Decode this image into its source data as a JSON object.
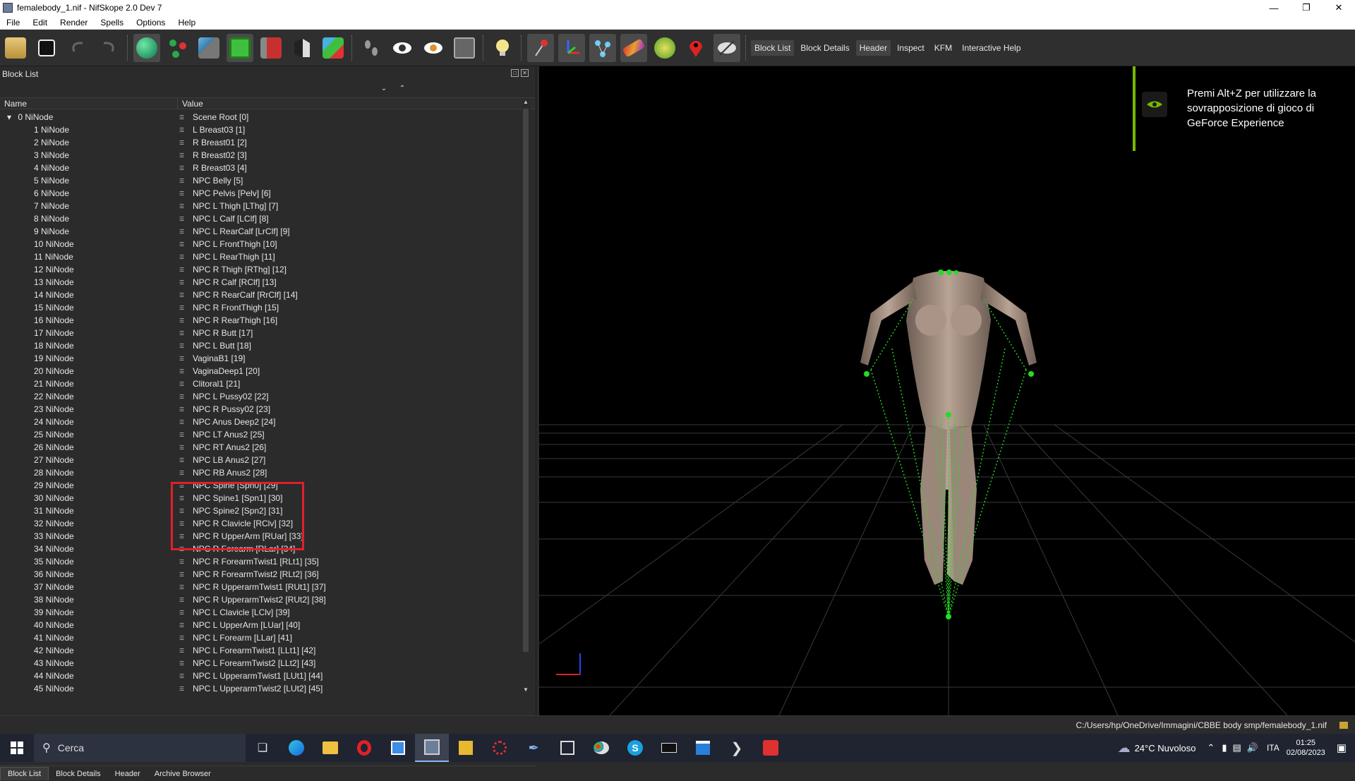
{
  "window": {
    "title": "femalebody_1.nif - NifSkope 2.0 Dev 7"
  },
  "menu": [
    "File",
    "Edit",
    "Render",
    "Spells",
    "Options",
    "Help"
  ],
  "toolbar_text": [
    {
      "label": "Block List",
      "active": true
    },
    {
      "label": "Block Details",
      "active": false
    },
    {
      "label": "Header",
      "active": true
    },
    {
      "label": "Inspect",
      "active": false
    },
    {
      "label": "KFM",
      "active": false
    },
    {
      "label": "Interactive Help",
      "active": false
    }
  ],
  "panel": {
    "title": "Block List",
    "col_name": "Name",
    "col_value": "Value"
  },
  "rows": [
    {
      "name": "0 NiNode",
      "value": "Scene Root [0]",
      "root": true
    },
    {
      "name": "1 NiNode",
      "value": "L Breast03 [1]"
    },
    {
      "name": "2 NiNode",
      "value": "R Breast01 [2]"
    },
    {
      "name": "3 NiNode",
      "value": "R Breast02 [3]"
    },
    {
      "name": "4 NiNode",
      "value": "R Breast03 [4]"
    },
    {
      "name": "5 NiNode",
      "value": "NPC Belly [5]"
    },
    {
      "name": "6 NiNode",
      "value": "NPC Pelvis [Pelv] [6]"
    },
    {
      "name": "7 NiNode",
      "value": "NPC L Thigh [LThg] [7]"
    },
    {
      "name": "8 NiNode",
      "value": "NPC L Calf [LClf] [8]"
    },
    {
      "name": "9 NiNode",
      "value": "NPC L RearCalf [LrClf] [9]"
    },
    {
      "name": "10 NiNode",
      "value": "NPC L FrontThigh [10]"
    },
    {
      "name": "11 NiNode",
      "value": "NPC L RearThigh [11]"
    },
    {
      "name": "12 NiNode",
      "value": "NPC R Thigh [RThg] [12]"
    },
    {
      "name": "13 NiNode",
      "value": "NPC R Calf [RClf] [13]"
    },
    {
      "name": "14 NiNode",
      "value": "NPC R RearCalf [RrClf] [14]"
    },
    {
      "name": "15 NiNode",
      "value": "NPC R FrontThigh [15]"
    },
    {
      "name": "16 NiNode",
      "value": "NPC R RearThigh [16]"
    },
    {
      "name": "17 NiNode",
      "value": "NPC R Butt [17]"
    },
    {
      "name": "18 NiNode",
      "value": "NPC L Butt [18]"
    },
    {
      "name": "19 NiNode",
      "value": "VaginaB1 [19]"
    },
    {
      "name": "20 NiNode",
      "value": "VaginaDeep1 [20]"
    },
    {
      "name": "21 NiNode",
      "value": "Clitoral1 [21]"
    },
    {
      "name": "22 NiNode",
      "value": "NPC L Pussy02 [22]"
    },
    {
      "name": "23 NiNode",
      "value": "NPC R Pussy02 [23]"
    },
    {
      "name": "24 NiNode",
      "value": "NPC Anus Deep2 [24]"
    },
    {
      "name": "25 NiNode",
      "value": "NPC LT Anus2 [25]"
    },
    {
      "name": "26 NiNode",
      "value": "NPC RT Anus2 [26]"
    },
    {
      "name": "27 NiNode",
      "value": "NPC LB Anus2 [27]"
    },
    {
      "name": "28 NiNode",
      "value": "NPC RB Anus2 [28]"
    },
    {
      "name": "29 NiNode",
      "value": "NPC Spine [Spn0] [29]"
    },
    {
      "name": "30 NiNode",
      "value": "NPC Spine1 [Spn1] [30]"
    },
    {
      "name": "31 NiNode",
      "value": "NPC Spine2 [Spn2] [31]"
    },
    {
      "name": "32 NiNode",
      "value": "NPC R Clavicle [RClv] [32]"
    },
    {
      "name": "33 NiNode",
      "value": "NPC R UpperArm [RUar] [33]"
    },
    {
      "name": "34 NiNode",
      "value": "NPC R Forearm [RLar] [34]"
    },
    {
      "name": "35 NiNode",
      "value": "NPC R ForearmTwist1 [RLt1] [35]"
    },
    {
      "name": "36 NiNode",
      "value": "NPC R ForearmTwist2 [RLt2] [36]"
    },
    {
      "name": "37 NiNode",
      "value": "NPC R UpperarmTwist1 [RUt1] [37]"
    },
    {
      "name": "38 NiNode",
      "value": "NPC R UpperarmTwist2 [RUt2] [38]"
    },
    {
      "name": "39 NiNode",
      "value": "NPC L Clavicle [LClv] [39]"
    },
    {
      "name": "40 NiNode",
      "value": "NPC L UpperArm [LUar] [40]"
    },
    {
      "name": "41 NiNode",
      "value": "NPC L Forearm [LLar] [41]"
    },
    {
      "name": "42 NiNode",
      "value": "NPC L ForearmTwist1 [LLt1] [42]"
    },
    {
      "name": "43 NiNode",
      "value": "NPC L ForearmTwist2 [LLt2] [43]"
    },
    {
      "name": "44 NiNode",
      "value": "NPC L UpperarmTwist1 [LUt1] [44]"
    },
    {
      "name": "45 NiNode",
      "value": "NPC L UpperarmTwist2 [LUt2] [45]"
    }
  ],
  "bottom_tabs": [
    {
      "label": "Block List",
      "active": true
    },
    {
      "label": "Block Details",
      "active": false
    },
    {
      "label": "Header",
      "active": false
    },
    {
      "label": "Archive Browser",
      "active": false
    }
  ],
  "overlay": {
    "text": "Premi Alt+Z per utilizzare la sovrapposizione di gioco di GeForce Experience",
    "accent": "#76b900"
  },
  "status": {
    "path": "C:/Users/hp/OneDrive/Immagini/CBBE body smp/femalebody_1.nif"
  },
  "taskbar": {
    "search_placeholder": "Cerca",
    "weather": "24°C  Nuvoloso",
    "lang": "ITA",
    "time": "01:25",
    "date": "02/08/2023"
  },
  "colors": {
    "highlight": "#e0202a",
    "bone": "#22dd22",
    "grid": "#3a3a3a"
  }
}
